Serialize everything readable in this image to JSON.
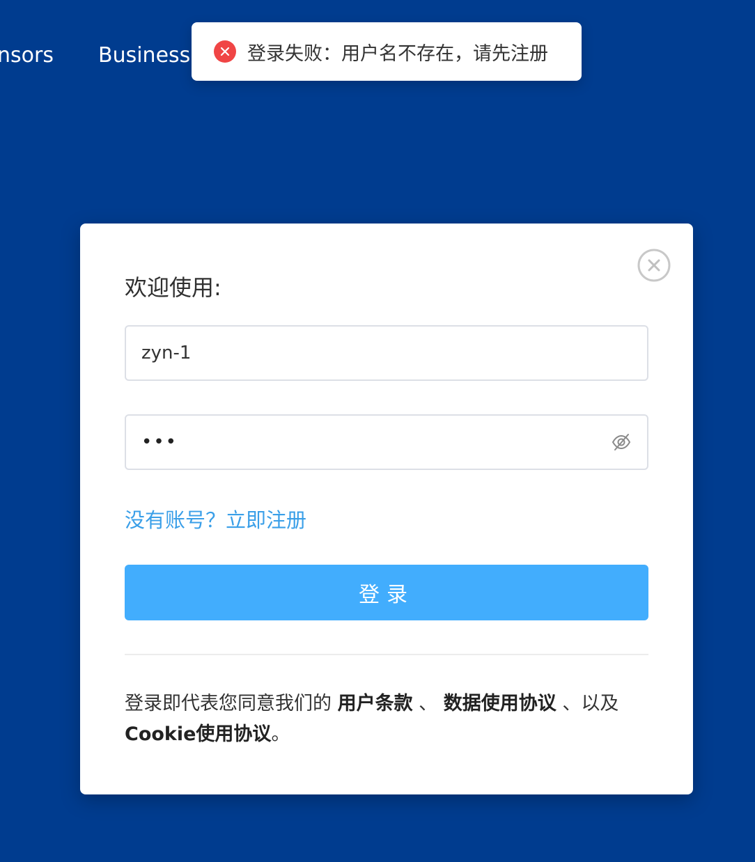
{
  "nav": {
    "items": [
      {
        "label": "nsors"
      },
      {
        "label": "Business ."
      }
    ]
  },
  "toast": {
    "icon": "error-circle-icon",
    "icon_color": "#f04545",
    "message": "登录失败：用户名不存在，请先注册"
  },
  "modal": {
    "title": "欢迎使用:",
    "close_icon": "close-circle-icon",
    "username": {
      "value": "zyn-1"
    },
    "password": {
      "masked_value": "•••",
      "toggle_icon": "eye-off-icon"
    },
    "register_link": "没有账号？立即注册",
    "login_button": "登录",
    "terms": {
      "prefix": "登录即代表您同意我们的 ",
      "user_terms": "用户条款",
      "sep1": " 、 ",
      "data_agreement": "数据使用协议",
      "sep2": " 、以及 ",
      "cookie_agreement": "Cookie使用协议",
      "suffix": "。"
    }
  },
  "colors": {
    "background": "#003c8f",
    "link": "#3a9fe8",
    "primary_button": "#42adfd",
    "error": "#f04545"
  }
}
